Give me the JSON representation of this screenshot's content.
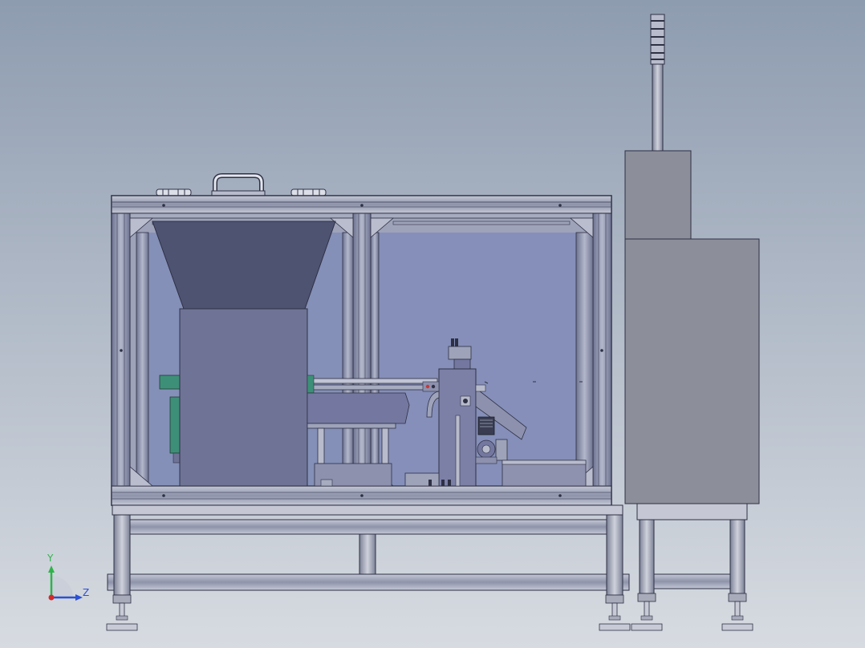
{
  "viewport": {
    "background_top": "#8e9cb0",
    "background_bottom": "#d7dbe1"
  },
  "colors": {
    "frame": "#9aa0b6",
    "frame_dark": "#4d5068",
    "frame_edge": "#2e3044",
    "glass": "#8590b8",
    "glass_light": "#9aa3c8",
    "hopper": "#4e5372",
    "bin": "#6f7396",
    "green_part": "#3e8f78",
    "cabinet": "#8c8e9a",
    "cabinet_dark": "#6e707c",
    "accent_red": "#c23a3a"
  },
  "triad": {
    "y_label": "Y",
    "z_label": "Z",
    "y_color": "#2fb34a",
    "z_color": "#2b4fd6",
    "x_color": "#d42a2a"
  }
}
